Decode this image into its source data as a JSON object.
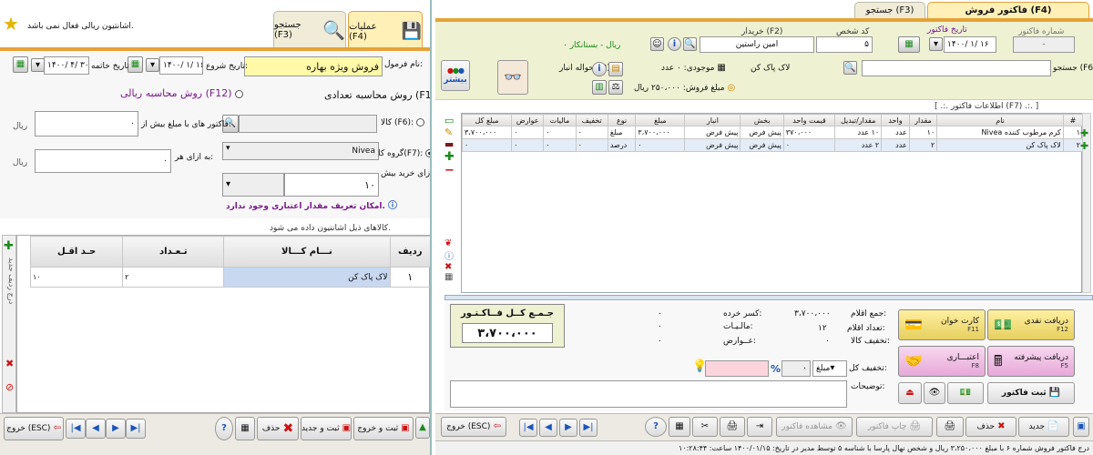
{
  "left": {
    "info_text": "اشانتیون ریالی فعال نمی باشد.",
    "tabs": {
      "operations": "عملیات (F4)",
      "search": "جستجو (F3)"
    },
    "form_name_label": "نام فرمول:",
    "form_name_value": "فروش ویژه بهاره",
    "start_date_label": "تاریخ شروع:",
    "start_date_value": "۱۴۰۰/ ۱/ ۱۶",
    "end_date_label": "تاریخ خاتمه",
    "end_date_value": "۱۴۰۰/ ۴/ ۳۰",
    "radio_qty": "روش محاسبه تعدادی (F11)",
    "radio_rial": "روش محاسبه ریالی (F12)",
    "goods_label": "کالا (F6):",
    "group_label": "گروه کالا(F7):",
    "group_value": "Nivea",
    "per_buy_label": "به ازای خرید بیش:",
    "per_buy_value": "۱۰",
    "invoice_over_label": "فاکتور های با مبلغ بیش از:",
    "invoice_over_value": "۰",
    "per_every_label": "به ازای هر:",
    "per_every_value": "۰",
    "currency": "ریال",
    "warning": "امکان تعریف مقدار اعتباری وجود ندارد.",
    "gift_caption": "کالاهای ذیل اشانتیون داده می شود.",
    "grid_headers": {
      "row": "ردیف",
      "name": "نـــام کـــالا",
      "qty": "تـعـداد",
      "min": "حـد اقـل"
    },
    "grid_rows": [
      {
        "row": "۱",
        "name": "لاک پاک کن",
        "qty": "۲",
        "min": "۱۰"
      }
    ],
    "side_tab": "درج ردیف جدید",
    "footer": {
      "save_exit": "ثبت و خروج",
      "save_new": "ثبت و جدید",
      "delete": "حذف",
      "exit": "خروج (ESC)"
    }
  },
  "right": {
    "tabs": {
      "invoice": "فاکتور فروش (F4)",
      "search": "جستجو (F3)"
    },
    "invoice_no_label": "شماره فاکتور",
    "invoice_no_value": "۰",
    "invoice_date_label": "تاریخ فاکتور",
    "invoice_date_value": "۱۴۰۰/ ۱/ ۱۶",
    "person_code_label": "کد شخص",
    "person_code_value": "۵",
    "buyer_label": "خریدار (F2)",
    "buyer_value": "امین راستین",
    "debt_text": "۰ ریال - بستانکار",
    "search_label": "جستجو (F6) :",
    "item_name": "لاک پاک کن",
    "stock_label": "موجودی: ۰ عدد",
    "sale_price_label": "مبلغ فروش: ۲۵۰،۰۰۰ ریال",
    "warehouse_label": "حواله انبار(F9)",
    "more_button": "بیشتر",
    "info_bar": "[ .:. اطلاعات فاکتور (F7) .:. ]",
    "grid_headers": [
      "#",
      "نام",
      "مقدار",
      "واحد",
      "مقدار/تبدیل",
      "قیمت واحد",
      "بخش",
      "انبار",
      "مبلغ",
      "نوع",
      "تخفیف",
      "مالیات",
      "عوارض",
      "مبلغ کل"
    ],
    "grid_rows": [
      [
        "۱",
        "کرم مرطوب کننده Nivea",
        "۱۰",
        "عدد",
        "۱۰ عدد",
        "۳۷۰،۰۰۰",
        "پیش فرض",
        "پیش فرض",
        "۳،۷۰۰،۰۰۰",
        "مبلغ",
        "۰",
        "۰",
        "۰",
        "۳،۷۰۰،۰۰۰"
      ],
      [
        "۲",
        "لاک پاک کن",
        "۲",
        "عدد",
        "۲ عدد",
        "۰",
        "پیش فرض",
        "پیش فرض",
        "۰",
        "درصد",
        "۰",
        "۰",
        "۰",
        "۰"
      ]
    ],
    "total_title": "جـمـع کــل فــاکـتـور",
    "total_value": "۳،۷۰۰،۰۰۰",
    "sum_items_label": "جمع اقلام:",
    "sum_items_value": "۳،۷۰۰،۰۰۰",
    "count_items_label": "تعداد اقلام:",
    "count_items_value": "۱۲",
    "goods_discount_label": "تخفیف کالا:",
    "goods_discount_value": "۰",
    "rounding_label": "کسر خرده:",
    "rounding_value": "۰",
    "tax_label": "مالـیـات:",
    "tax_value": "۰",
    "duties_label": "عــوارض:",
    "duties_value": "۰",
    "total_discount_label": "تخفیف کل:",
    "discount_type": "مبلغ",
    "discount_value": "۰",
    "percent_sign": "%",
    "notes_label": "توضیحات:",
    "pay_cash": "دریافت نقدی",
    "pay_cash_key": "F12",
    "pay_card": "کارت خوان",
    "pay_card_key": "F11",
    "pay_adv": "دریافت پیشرفته",
    "pay_adv_key": "F5",
    "pay_credit": "اعتبـــاری",
    "pay_credit_key": "F8",
    "save_invoice": "ثبت فاکتور",
    "footer": {
      "new": "جدید",
      "delete": "حذف",
      "print_invoice": "چاپ فاکتور",
      "view_invoice": "مشاهده فاکتور",
      "exit": "خروج (ESC)"
    },
    "status_bar": "درج فاکتور فروش شماره ۶ با مبلغ ۳،۲۵۰،۰۰۰ ریال و شخص نهال پارسا با شناسه ۵ توسط مدیر در تاریخ: ۱۴۰۰/۰۱/۱۵ ساعت: ۱۰:۲۸:۴۴"
  },
  "colors": {
    "yellow": "#fff9a8",
    "blue": "#1a55b8",
    "green": "#1b8a1b",
    "purple": "#7a1a8a",
    "red": "#cc1111"
  }
}
